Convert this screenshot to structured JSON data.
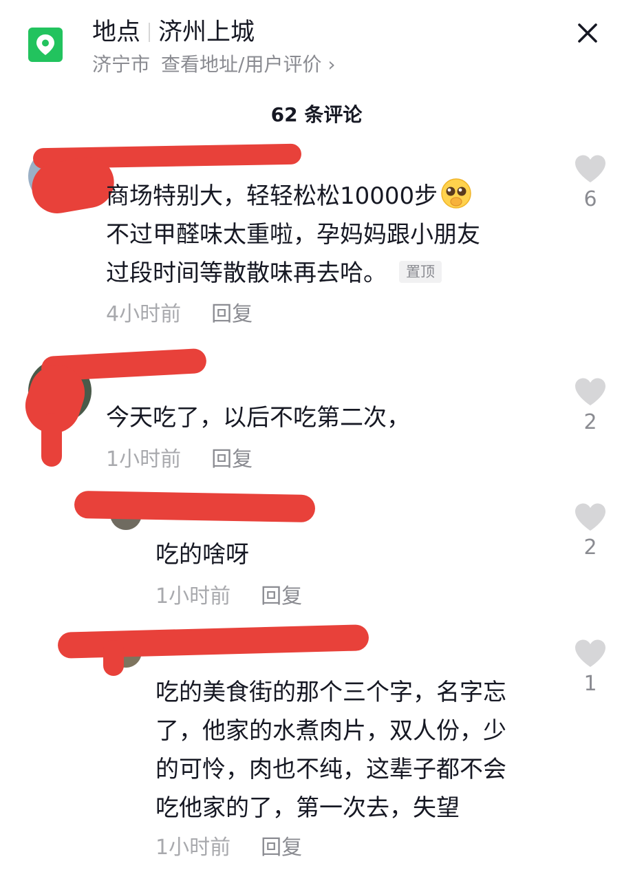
{
  "header": {
    "title_label": "地点",
    "title_place": "济州上城",
    "city": "济宁市",
    "view_link": "查看地址/用户评价 ›",
    "close_icon": "close-icon",
    "location_icon": "location-pin-icon",
    "accent_color": "#22c35e"
  },
  "comments_title": "62 条评论",
  "comments": [
    {
      "lines": [
        "商场特别大，轻轻松松10000步",
        "不过甲醛味太重啦，孕妈妈跟小朋友",
        "过段时间等散散味再去哈。"
      ],
      "pinned_label": "置顶",
      "time": "4小时前",
      "reply": "回复",
      "likes": "6"
    },
    {
      "lines": [
        "今天吃了，以后不吃第二次，"
      ],
      "time": "1小时前",
      "reply": "回复",
      "likes": "2"
    },
    {
      "lines": [
        "吃的啥呀"
      ],
      "time": "1小时前",
      "reply": "回复",
      "likes": "2"
    },
    {
      "lines": [
        "吃的美食街的那个三个字，名字忘",
        "了，他家的水煮肉片，双人份，少",
        "的可怜，肉也不纯，这辈子都不会",
        "吃他家的了，第一次去，失望"
      ],
      "time": "1小时前",
      "reply": "回复",
      "likes": "1"
    }
  ]
}
